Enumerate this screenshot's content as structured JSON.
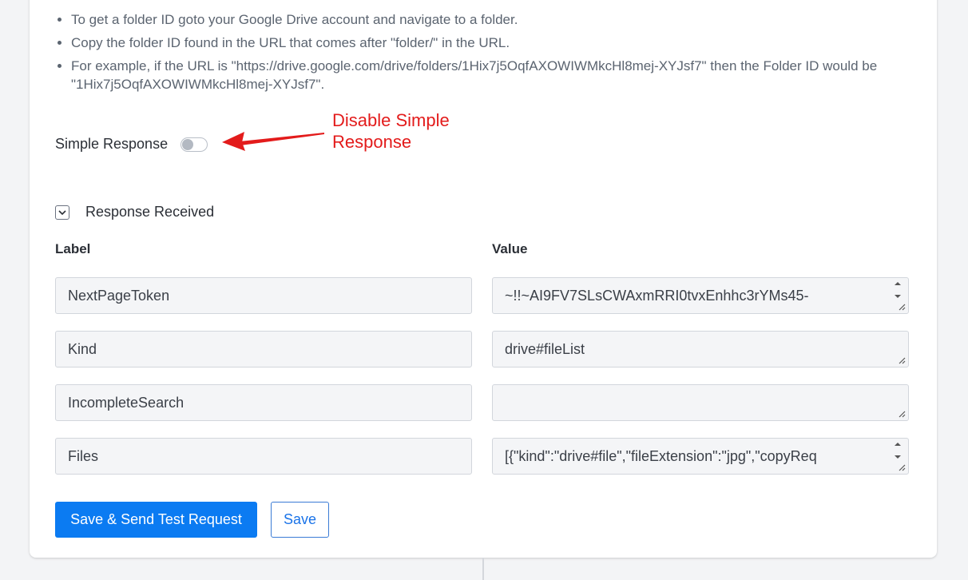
{
  "instructions": [
    "To get a folder ID goto your Google Drive account and navigate to a folder.",
    "Copy the folder ID found in the URL that comes after \"folder/\" in the URL.",
    "For example, if the URL is \"https://drive.google.com/drive/folders/1Hix7j5OqfAXOWIWMkcHl8mej-XYJsf7\" then the Folder ID would be \"1Hix7j5OqfAXOWIWMkcHl8mej-XYJsf7\"."
  ],
  "simple_response": {
    "label": "Simple Response",
    "enabled": false
  },
  "annotation": {
    "text": "Disable Simple Response",
    "color": "#e31b1b"
  },
  "response_section": {
    "title": "Response Received",
    "label_header": "Label",
    "value_header": "Value",
    "rows": [
      {
        "label": "NextPageToken",
        "value": "~!!~AI9FV7SLsCWAxmRRI0tvxEnhhc3rYMs45-"
      },
      {
        "label": "Kind",
        "value": "drive#fileList"
      },
      {
        "label": "IncompleteSearch",
        "value": ""
      },
      {
        "label": "Files",
        "value": "[{\"kind\":\"drive#file\",\"fileExtension\":\"jpg\",\"copyReq"
      }
    ]
  },
  "buttons": {
    "primary": "Save & Send Test Request",
    "secondary": "Save"
  },
  "colors": {
    "primary_button": "#0b7bf2",
    "accent_text": "#1a73e8",
    "background": "#f3f4f6",
    "card": "#ffffff"
  }
}
